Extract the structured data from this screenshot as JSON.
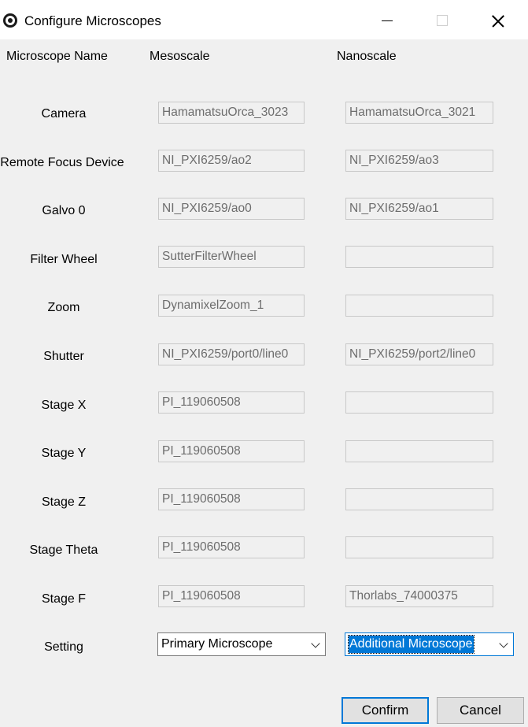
{
  "window": {
    "title": "Configure Microscopes"
  },
  "headers": {
    "name": "Microscope Name",
    "mesoscale": "Mesoscale",
    "nanoscale": "Nanoscale"
  },
  "rows": [
    {
      "label": "Camera",
      "mesoscale": "HamamatsuOrca_3023",
      "nanoscale": "HamamatsuOrca_3021"
    },
    {
      "label": "Remote Focus Device",
      "mesoscale": "NI_PXI6259/ao2",
      "nanoscale": "NI_PXI6259/ao3"
    },
    {
      "label": "Galvo 0",
      "mesoscale": "NI_PXI6259/ao0",
      "nanoscale": "NI_PXI6259/ao1"
    },
    {
      "label": "Filter Wheel",
      "mesoscale": "SutterFilterWheel",
      "nanoscale": ""
    },
    {
      "label": "Zoom",
      "mesoscale": "DynamixelZoom_1",
      "nanoscale": ""
    },
    {
      "label": "Shutter",
      "mesoscale": "NI_PXI6259/port0/line0",
      "nanoscale": "NI_PXI6259/port2/line0"
    },
    {
      "label": "Stage X",
      "mesoscale": "PI_119060508",
      "nanoscale": ""
    },
    {
      "label": "Stage Y",
      "mesoscale": "PI_119060508",
      "nanoscale": ""
    },
    {
      "label": "Stage Z",
      "mesoscale": "PI_119060508",
      "nanoscale": ""
    },
    {
      "label": "Stage Theta",
      "mesoscale": "PI_119060508",
      "nanoscale": ""
    },
    {
      "label": "Stage F",
      "mesoscale": "PI_119060508",
      "nanoscale": "Thorlabs_74000375"
    }
  ],
  "setting": {
    "label": "Setting",
    "mesoscale": "Primary Microscope",
    "nanoscale": "Additional Microscope"
  },
  "buttons": {
    "confirm": "Confirm",
    "cancel": "Cancel"
  },
  "colors": {
    "accent": "#0078d7",
    "background": "#f0f0f0",
    "disabled_text": "#6d6d6d"
  }
}
